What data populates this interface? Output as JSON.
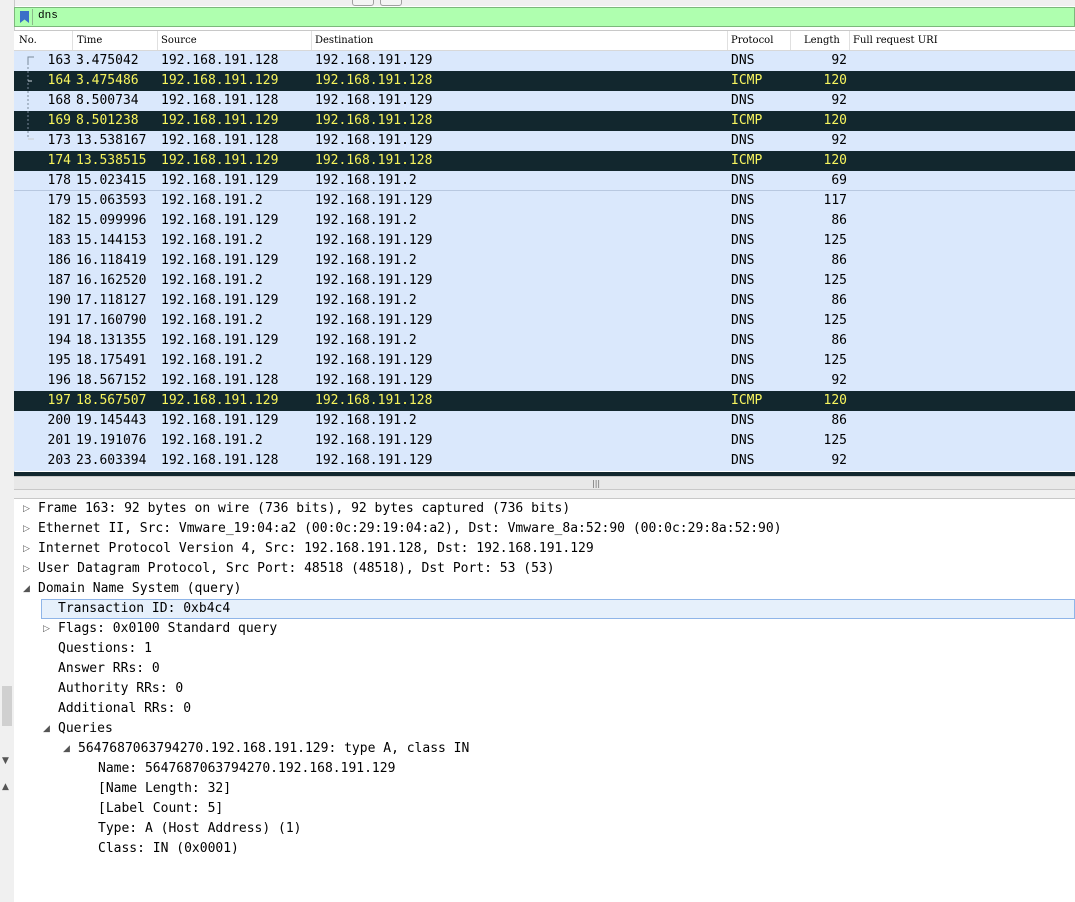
{
  "filter": {
    "value": "dns"
  },
  "columns": {
    "no": "No.",
    "time": "Time",
    "source": "Source",
    "destination": "Destination",
    "protocol": "Protocol",
    "length": "Length",
    "uri": "Full request URI"
  },
  "packets": [
    {
      "no": "163",
      "time": "3.475042",
      "src": "192.168.191.128",
      "dst": "192.168.191.129",
      "proto": "DNS",
      "len": "92"
    },
    {
      "no": "164",
      "time": "3.475486",
      "src": "192.168.191.129",
      "dst": "192.168.191.128",
      "proto": "ICMP",
      "len": "120"
    },
    {
      "no": "168",
      "time": "8.500734",
      "src": "192.168.191.128",
      "dst": "192.168.191.129",
      "proto": "DNS",
      "len": "92"
    },
    {
      "no": "169",
      "time": "8.501238",
      "src": "192.168.191.129",
      "dst": "192.168.191.128",
      "proto": "ICMP",
      "len": "120"
    },
    {
      "no": "173",
      "time": "13.538167",
      "src": "192.168.191.128",
      "dst": "192.168.191.129",
      "proto": "DNS",
      "len": "92"
    },
    {
      "no": "174",
      "time": "13.538515",
      "src": "192.168.191.129",
      "dst": "192.168.191.128",
      "proto": "ICMP",
      "len": "120"
    },
    {
      "no": "178",
      "time": "15.023415",
      "src": "192.168.191.129",
      "dst": "192.168.191.2",
      "proto": "DNS",
      "len": "69"
    },
    {
      "no": "179",
      "time": "15.063593",
      "src": "192.168.191.2",
      "dst": "192.168.191.129",
      "proto": "DNS",
      "len": "117"
    },
    {
      "no": "182",
      "time": "15.099996",
      "src": "192.168.191.129",
      "dst": "192.168.191.2",
      "proto": "DNS",
      "len": "86"
    },
    {
      "no": "183",
      "time": "15.144153",
      "src": "192.168.191.2",
      "dst": "192.168.191.129",
      "proto": "DNS",
      "len": "125"
    },
    {
      "no": "186",
      "time": "16.118419",
      "src": "192.168.191.129",
      "dst": "192.168.191.2",
      "proto": "DNS",
      "len": "86"
    },
    {
      "no": "187",
      "time": "16.162520",
      "src": "192.168.191.2",
      "dst": "192.168.191.129",
      "proto": "DNS",
      "len": "125"
    },
    {
      "no": "190",
      "time": "17.118127",
      "src": "192.168.191.129",
      "dst": "192.168.191.2",
      "proto": "DNS",
      "len": "86"
    },
    {
      "no": "191",
      "time": "17.160790",
      "src": "192.168.191.2",
      "dst": "192.168.191.129",
      "proto": "DNS",
      "len": "125"
    },
    {
      "no": "194",
      "time": "18.131355",
      "src": "192.168.191.129",
      "dst": "192.168.191.2",
      "proto": "DNS",
      "len": "86"
    },
    {
      "no": "195",
      "time": "18.175491",
      "src": "192.168.191.2",
      "dst": "192.168.191.129",
      "proto": "DNS",
      "len": "125"
    },
    {
      "no": "196",
      "time": "18.567152",
      "src": "192.168.191.128",
      "dst": "192.168.191.129",
      "proto": "DNS",
      "len": "92"
    },
    {
      "no": "197",
      "time": "18.567507",
      "src": "192.168.191.129",
      "dst": "192.168.191.128",
      "proto": "ICMP",
      "len": "120"
    },
    {
      "no": "200",
      "time": "19.145443",
      "src": "192.168.191.129",
      "dst": "192.168.191.2",
      "proto": "DNS",
      "len": "86"
    },
    {
      "no": "201",
      "time": "19.191076",
      "src": "192.168.191.2",
      "dst": "192.168.191.129",
      "proto": "DNS",
      "len": "125"
    },
    {
      "no": "203",
      "time": "23.603394",
      "src": "192.168.191.128",
      "dst": "192.168.191.129",
      "proto": "DNS",
      "len": "92"
    }
  ],
  "details": [
    "Frame 163: 92 bytes on wire (736 bits), 92 bytes captured (736 bits)",
    "Ethernet II, Src: Vmware_19:04:a2 (00:0c:29:19:04:a2), Dst: Vmware_8a:52:90 (00:0c:29:8a:52:90)",
    "Internet Protocol Version 4, Src: 192.168.191.128, Dst: 192.168.191.129",
    "User Datagram Protocol, Src Port: 48518 (48518), Dst Port: 53 (53)",
    "Domain Name System (query)",
    "Transaction ID: 0xb4c4",
    "Flags: 0x0100 Standard query",
    "Questions: 1",
    "Answer RRs: 0",
    "Authority RRs: 0",
    "Additional RRs: 0",
    "Queries",
    "5647687063794270.192.168.191.129: type A, class IN",
    "Name: 5647687063794270.192.168.191.129",
    "[Name Length: 32]",
    "[Label Count: 5]",
    "Type: A (Host Address) (1)",
    "Class: IN (0x0001)"
  ],
  "colors": {
    "dns_row": "#dae8fc",
    "icmp_row": "#12272e",
    "icmp_text": "#f7f45f",
    "filter_ok": "#afffaf"
  }
}
